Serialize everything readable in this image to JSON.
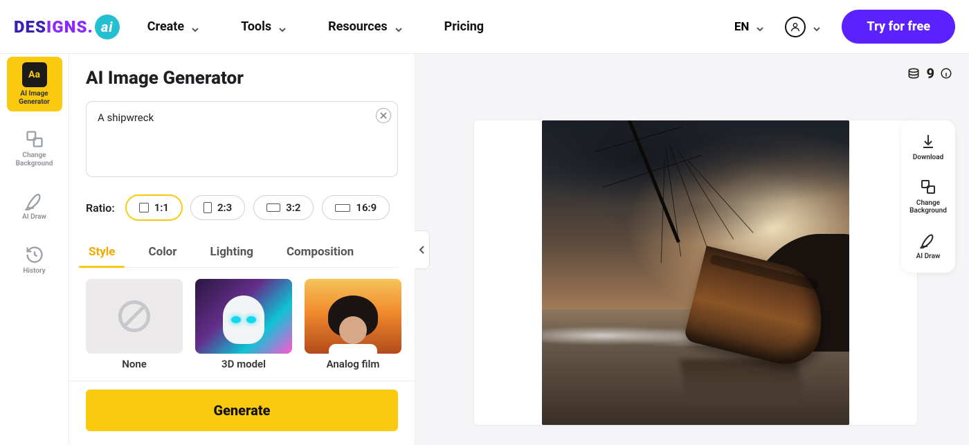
{
  "header": {
    "logo_text": "DESIGNS.",
    "logo_badge": "ai",
    "nav": [
      "Create",
      "Tools",
      "Resources",
      "Pricing"
    ],
    "language": "EN",
    "cta": "Try for free"
  },
  "left_rail": {
    "items": [
      {
        "label": "AI Image Generator",
        "icon_text": "Aa",
        "active": true
      },
      {
        "label": "Change Background"
      },
      {
        "label": "AI Draw"
      },
      {
        "label": "History"
      }
    ]
  },
  "panel": {
    "title": "AI Image Generator",
    "prompt_value": "A shipwreck",
    "ratio_label": "Ratio:",
    "ratios": [
      "1:1",
      "2:3",
      "3:2",
      "16:9"
    ],
    "ratio_active": "1:1",
    "tabs": [
      "Style",
      "Color",
      "Lighting",
      "Composition"
    ],
    "tab_active": "Style",
    "styles": [
      {
        "name": "None"
      },
      {
        "name": "3D model"
      },
      {
        "name": "Analog film"
      }
    ],
    "generate_label": "Generate"
  },
  "canvas": {
    "credits": "9"
  },
  "right_rail": {
    "items": [
      "Download",
      "Change Background",
      "AI Draw"
    ]
  }
}
